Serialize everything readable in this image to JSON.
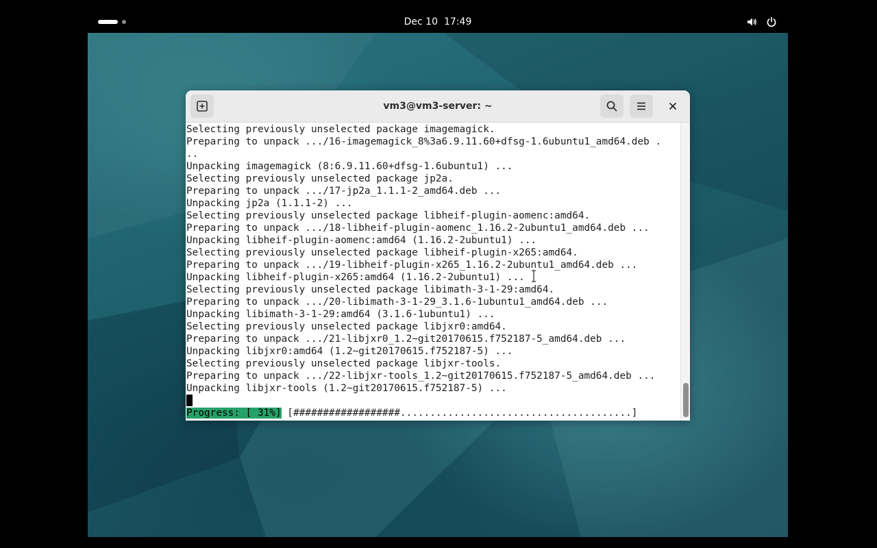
{
  "topbar": {
    "clock_date": "Dec 10",
    "clock_time": "17:49",
    "icons": [
      "activities-indicator",
      "volume-icon",
      "power-icon"
    ]
  },
  "window": {
    "title": "vm3@vm3-server: ~",
    "buttons": [
      "new-tab-icon",
      "search-icon",
      "menu-icon",
      "close-icon"
    ]
  },
  "terminal": {
    "lines": [
      "Selecting previously unselected package imagemagick.",
      "Preparing to unpack .../16-imagemagick_8%3a6.9.11.60+dfsg-1.6ubuntu1_amd64.deb .",
      "..",
      "Unpacking imagemagick (8:6.9.11.60+dfsg-1.6ubuntu1) ...",
      "Selecting previously unselected package jp2a.",
      "Preparing to unpack .../17-jp2a_1.1.1-2_amd64.deb ...",
      "Unpacking jp2a (1.1.1-2) ...",
      "Selecting previously unselected package libheif-plugin-aomenc:amd64.",
      "Preparing to unpack .../18-libheif-plugin-aomenc_1.16.2-2ubuntu1_amd64.deb ...",
      "Unpacking libheif-plugin-aomenc:amd64 (1.16.2-2ubuntu1) ...",
      "Selecting previously unselected package libheif-plugin-x265:amd64.",
      "Preparing to unpack .../19-libheif-plugin-x265_1.16.2-2ubuntu1_amd64.deb ...",
      "Unpacking libheif-plugin-x265:amd64 (1.16.2-2ubuntu1) ...",
      "Selecting previously unselected package libimath-3-1-29:amd64.",
      "Preparing to unpack .../20-libimath-3-1-29_3.1.6-1ubuntu1_amd64.deb ...",
      "Unpacking libimath-3-1-29:amd64 (3.1.6-1ubuntu1) ...",
      "Selecting previously unselected package libjxr0:amd64.",
      "Preparing to unpack .../21-libjxr0_1.2~git20170615.f752187-5_amd64.deb ...",
      "Unpacking libjxr0:amd64 (1.2~git20170615.f752187-5) ...",
      "Selecting previously unselected package libjxr-tools.",
      "Preparing to unpack .../22-libjxr-tools_1.2~git20170615.f752187-5_amd64.deb ...",
      "Unpacking libjxr-tools (1.2~git20170615.f752187-5) ..."
    ],
    "progress_label": "Progress: [ 31%]",
    "progress_bar": " [##################.......................................]",
    "progress_percent": 31
  },
  "colors": {
    "progress_accent": "#26a269",
    "terminal_background": "#ffffff",
    "topbar_background": "#000000"
  }
}
